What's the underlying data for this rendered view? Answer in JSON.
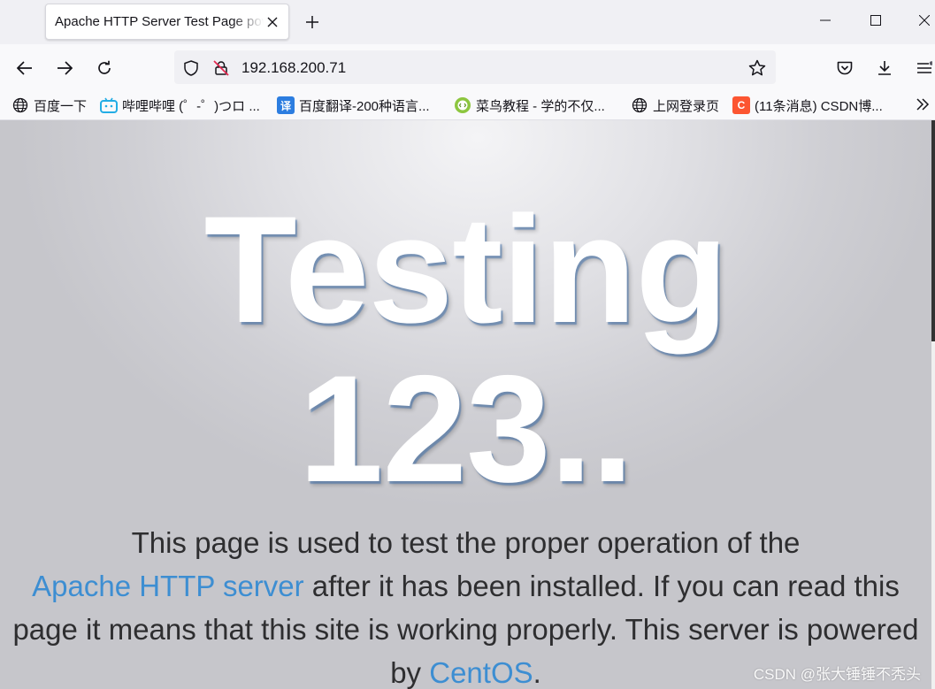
{
  "browser": {
    "tab": {
      "title": "Apache HTTP Server Test Page powered by CentOS"
    },
    "url": "192.168.200.71",
    "bookmarks": [
      {
        "label": "百度一下",
        "icon": "globe-icon"
      },
      {
        "label": "哔哩哔哩 (゜-゜)つロ ...",
        "icon": "bilibili-icon"
      },
      {
        "label": "百度翻译-200种语言...",
        "icon": "translate-icon",
        "icon_text": "译"
      },
      {
        "label": "菜鸟教程 - 学的不仅...",
        "icon": "runoob-icon"
      },
      {
        "label": "上网登录页",
        "icon": "globe-icon"
      },
      {
        "label": "(11条消息) CSDN博...",
        "icon": "csdn-icon",
        "icon_text": "C"
      }
    ]
  },
  "page": {
    "heading_line1": "Testing",
    "heading_line2": "123..",
    "para_1": "This page is used to test the proper operation of the",
    "apache_link": "Apache HTTP server",
    "para_2": " after it has been installed. If you can read this page it means that this site is working properly. This server is powered by ",
    "centos_link": "CentOS",
    "para_3": "."
  },
  "watermark": "CSDN @张大锤锤不秃头",
  "colors": {
    "link": "#3d8ed2",
    "csdn": "#fc5531",
    "bilibili": "#23ade5",
    "translate": "#2c7de0"
  }
}
